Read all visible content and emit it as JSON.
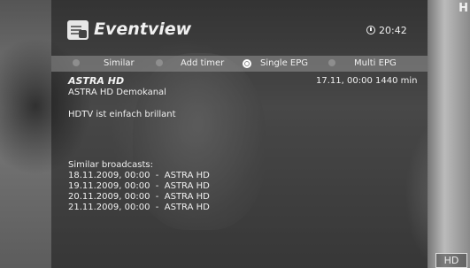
{
  "header": {
    "title": "Eventview",
    "time": "20:42"
  },
  "buttons": [
    {
      "label": "Similar",
      "color": "#8e8e8e",
      "active": false
    },
    {
      "label": "Add timer",
      "color": "#8e8e8e",
      "active": false
    },
    {
      "label": "Single EPG",
      "color": "#ffffff",
      "active": true
    },
    {
      "label": "Multi EPG",
      "color": "#8e8e8e",
      "active": false
    }
  ],
  "event": {
    "channel": "ASTRA HD",
    "subtitle": "ASTRA HD Demokanal",
    "date": "17.11, 00:00",
    "duration": "1440 min",
    "description": "HDTV ist einfach brillant"
  },
  "similar": {
    "heading": "Similar broadcasts:",
    "items": [
      "18.11.2009, 00:00  -  ASTRA HD",
      "19.11.2009, 00:00  -  ASTRA HD",
      "20.11.2009, 00:00  -  ASTRA HD",
      "21.11.2009, 00:00  -  ASTRA HD"
    ]
  },
  "background": {
    "corner_text": "H",
    "hd_logo": "HD"
  }
}
